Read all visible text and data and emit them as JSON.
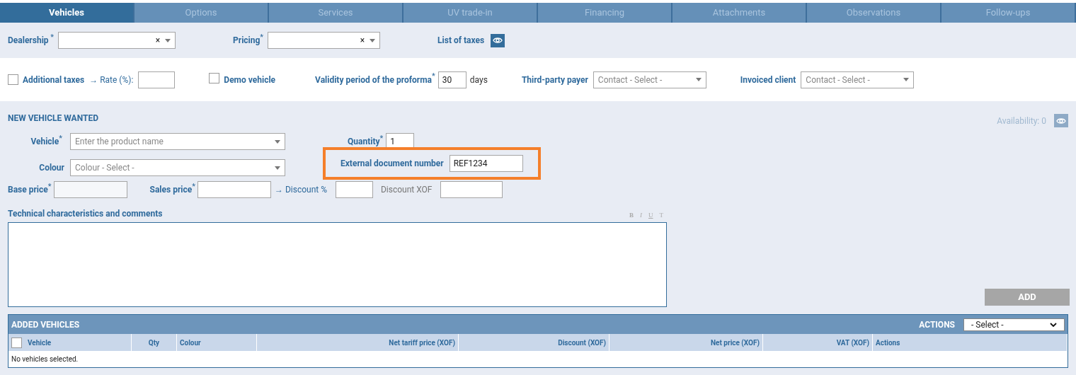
{
  "tabs": [
    {
      "label": "Vehicles",
      "selected": true
    },
    {
      "label": "Options",
      "selected": false
    },
    {
      "label": "Services",
      "selected": false
    },
    {
      "label": "UV trade-in",
      "selected": false
    },
    {
      "label": "Financing",
      "selected": false
    },
    {
      "label": "Attachments",
      "selected": false
    },
    {
      "label": "Observations",
      "selected": false
    },
    {
      "label": "Follow-ups",
      "selected": false
    }
  ],
  "header": {
    "dealership": {
      "label": "Dealership",
      "required_mark": " *",
      "clear": "×"
    },
    "pricing": {
      "label": "Pricing",
      "required_mark": "*",
      "clear": "×"
    },
    "taxes_link": "List of taxes"
  },
  "options": {
    "additional_taxes": {
      "label": "Additional taxes",
      "checked": false
    },
    "rate_label": "→ Rate (%):",
    "demo": {
      "label": "Demo vehicle",
      "checked": false
    },
    "validity": {
      "label": "Validity period of the proforma",
      "required_mark": "*",
      "value": "30",
      "unit": "days"
    },
    "third_party": {
      "label": "Third-party payer",
      "placeholder": "Contact - Select -"
    },
    "invoiced": {
      "label": "Invoiced client",
      "placeholder": "Contact - Select -"
    }
  },
  "section": {
    "title": "NEW VEHICLE WANTED",
    "availability": "Availability: 0",
    "vehicle": {
      "label": "Vehicle",
      "required_mark": "*",
      "placeholder": "Enter the product name"
    },
    "quantity": {
      "label": "Quantity",
      "required_mark": "*",
      "value": "1"
    },
    "colour": {
      "label": "Colour",
      "placeholder": "Colour - Select -"
    },
    "external": {
      "label": "External document number",
      "value": "REF1234",
      "highlighted": true
    },
    "base_price": {
      "label": "Base price",
      "required_mark": "*"
    },
    "sales_price": {
      "label": "Sales price",
      "required_mark": "*"
    },
    "discount_pct": "→ Discount %",
    "discount_xof": "Discount XOF",
    "comments_label": "Technical characteristics and comments",
    "editor_tools": [
      "B",
      "I",
      "U",
      "T"
    ],
    "add_button": "ADD"
  },
  "table": {
    "title": "ADDED VEHICLES",
    "actions_label": "ACTIONS",
    "actions_select": "- Select -",
    "select_all": false,
    "columns": [
      {
        "label": "Vehicle",
        "kind": "text"
      },
      {
        "label": "Qty",
        "kind": "count"
      },
      {
        "label": "Colour",
        "kind": "text"
      },
      {
        "label": "Net tariff price (XOF)",
        "kind": "amount"
      },
      {
        "label": "Discount (XOF)",
        "kind": "amount"
      },
      {
        "label": "Net price (XOF)",
        "kind": "amount"
      },
      {
        "label": "VAT (XOF)",
        "kind": "amount"
      },
      {
        "label": "Actions",
        "kind": "text"
      }
    ],
    "empty": "No vehicles selected."
  }
}
